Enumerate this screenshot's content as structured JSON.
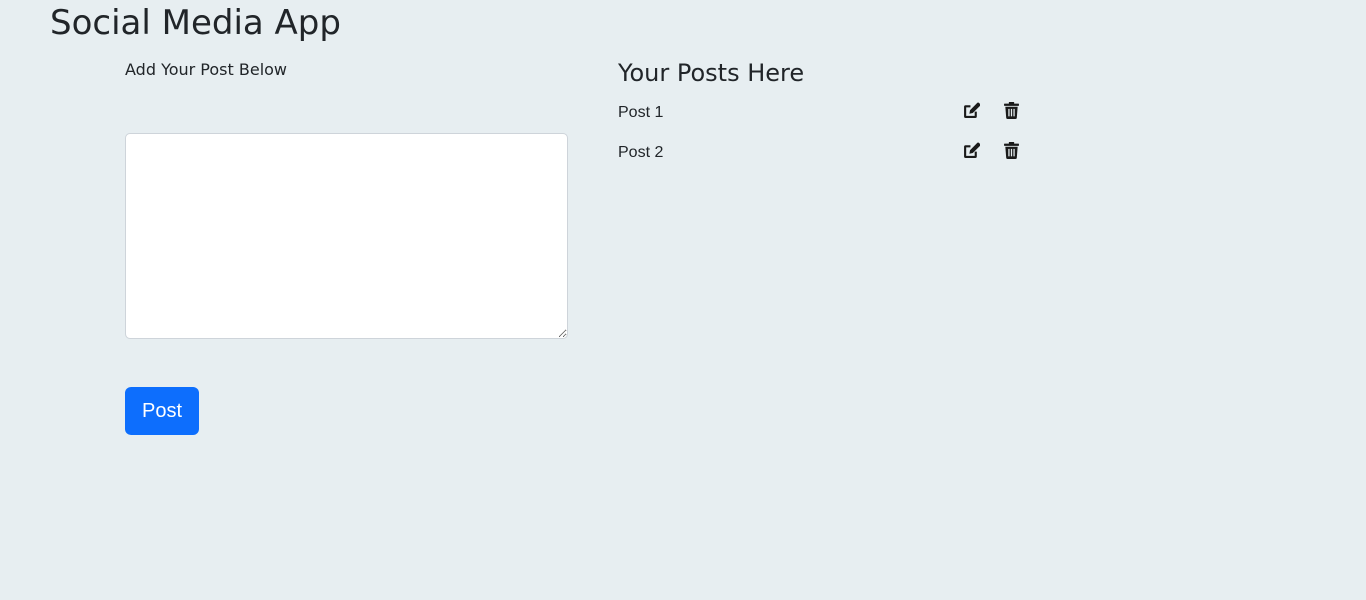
{
  "app": {
    "title": "Social Media App"
  },
  "composer": {
    "label": "Add Your Post Below",
    "textarea_value": "",
    "textarea_placeholder": "",
    "post_button_label": "Post"
  },
  "posts": {
    "heading": "Your Posts Here",
    "items": [
      {
        "text": "Post 1",
        "edit_icon": "edit-icon",
        "delete_icon": "trash-icon"
      },
      {
        "text": "Post 2",
        "edit_icon": "edit-icon",
        "delete_icon": "trash-icon"
      }
    ]
  },
  "colors": {
    "background": "#e7eef1",
    "primary_button": "#0d6efd",
    "text": "#212529",
    "icon": "#1a1a1a"
  }
}
